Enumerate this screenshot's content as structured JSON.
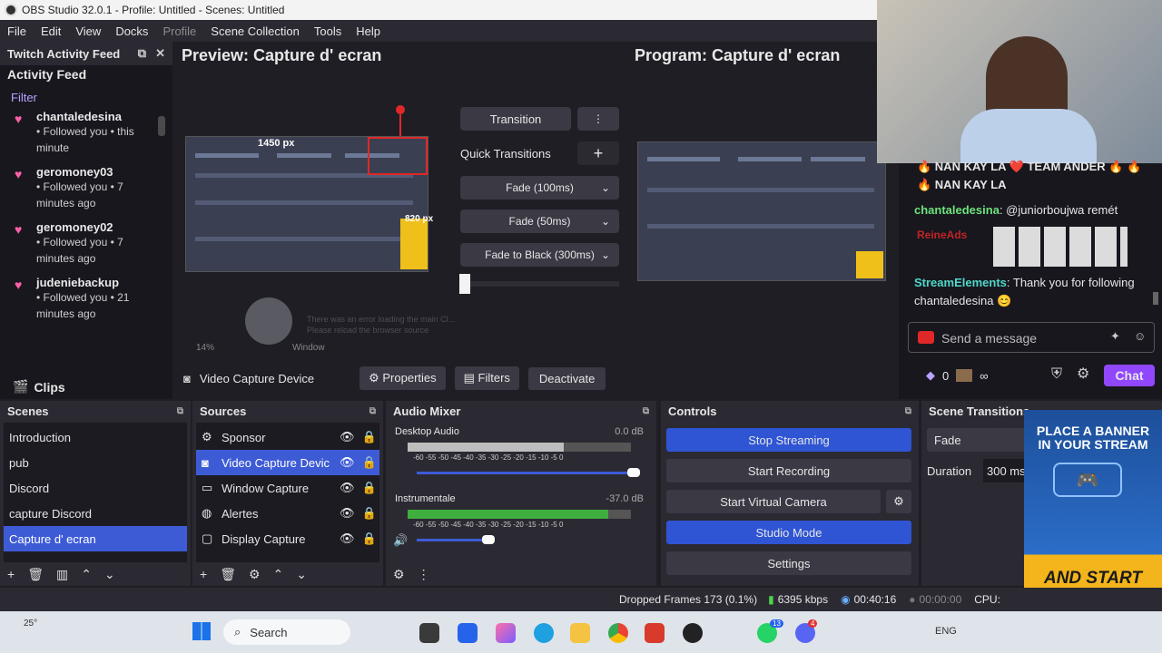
{
  "window": {
    "title": "OBS Studio 32.0.1 - Profile: Untitled - Scenes: Untitled"
  },
  "menu": [
    "File",
    "Edit",
    "View",
    "Docks",
    "Profile",
    "Scene Collection",
    "Tools",
    "Help"
  ],
  "feed": {
    "dock_title": "Twitch Activity Feed",
    "title": "Activity Feed",
    "filter": "Filter",
    "items": [
      {
        "user": "chantaledesina",
        "desc": "• Followed you • this minute"
      },
      {
        "user": "geromoney03",
        "desc": "• Followed you • 7 minutes ago"
      },
      {
        "user": "geromoney02",
        "desc": "• Followed you • 7 minutes ago"
      },
      {
        "user": "judeniebackup",
        "desc": "• Followed you • 21 minutes ago"
      }
    ],
    "clips": "Clips"
  },
  "preview": {
    "title": "Preview: Capture d' ecran",
    "width_label": "1450 px",
    "height_label": "820 px",
    "zoom": "14%",
    "window_label": "Window",
    "error_text": "There was an error loading the main Cl... Please reload the browser source"
  },
  "program": {
    "title": "Program: Capture d' ecran"
  },
  "transitions": {
    "transition": "Transition",
    "quick": "Quick Transitions",
    "items": [
      "Fade (100ms)",
      "Fade (50ms)",
      "Fade to Black (300ms)"
    ]
  },
  "source_bar": {
    "source": "Video Capture Device",
    "properties": "Properties",
    "filters": "Filters",
    "deactivate": "Deactivate"
  },
  "chat": {
    "line1": "🔥 NAN KAY LA ❤️ TEAM ANDER 🔥 🔥",
    "line2": "🔥 NAN KAY LA",
    "user1": "chantaledesina",
    "msg1": ": @juniorboujwa remét",
    "user2": "ReineAds",
    "se_user": "StreamElements",
    "se_msg": ": Thank you for following chantaledesina 😊",
    "placeholder": "Send a message",
    "points": "0",
    "infinity": "∞",
    "chat_btn": "Chat"
  },
  "scenes": {
    "title": "Scenes",
    "items": [
      "Introduction",
      "pub",
      "Discord",
      "capture Discord",
      "Capture d' ecran"
    ],
    "selected": 4
  },
  "sources": {
    "title": "Sources",
    "items": [
      "Sponsor",
      "Video Capture Devic",
      "Window Capture",
      "Alertes",
      "Display Capture"
    ],
    "selected": 1
  },
  "mixer": {
    "title": "Audio Mixer",
    "ch1": {
      "name": "Desktop Audio",
      "db": "0.0 dB",
      "level": 0.7
    },
    "ch2": {
      "name": "Instrumentale",
      "db": "-37.0 dB",
      "level": 0.9
    },
    "ticks": "-60 -55 -50 -45 -40 -35 -30 -25 -20 -15 -10 -5 0"
  },
  "controls": {
    "title": "Controls",
    "stop_streaming": "Stop Streaming",
    "start_recording": "Start Recording",
    "start_vcam": "Start Virtual Camera",
    "studio_mode": "Studio Mode",
    "settings": "Settings"
  },
  "scene_trans": {
    "title": "Scene Transitions",
    "fade": "Fade",
    "duration_label": "Duration",
    "duration": "300 ms"
  },
  "ad": {
    "top": "PLACE A BANNER IN YOUR STREAM",
    "bottom": "AND START EARNING TODAY!"
  },
  "status": {
    "dropped": "Dropped Frames 173 (0.1%)",
    "kbps": "6395 kbps",
    "live_time": "00:40:16",
    "rec_time": "00:00:00",
    "cpu": "CPU:"
  },
  "taskbar": {
    "weather": "25°",
    "search": "Search",
    "lang": "ENG",
    "badge1": "13",
    "badge2": "4"
  },
  "colors": {
    "accent": "#3e5bd6",
    "twitch": "#9147ff",
    "heart": "#ff5fa8"
  }
}
